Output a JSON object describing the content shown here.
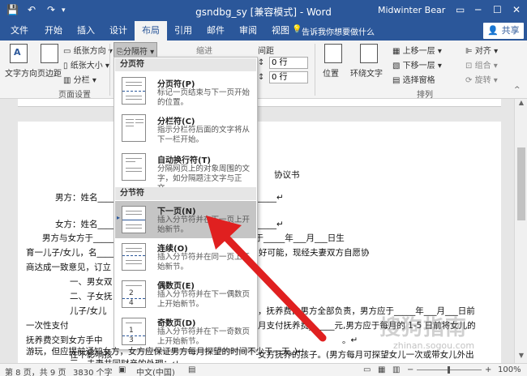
{
  "titlebar": {
    "save_glyph": "💾",
    "undo_glyph": "↶",
    "redo_glyph": "↷",
    "title": "gsndbg_sy [兼容模式] - Word",
    "user": "Midwinter Bear",
    "window_controls": [
      "▭",
      "─",
      "☐",
      "✕"
    ]
  },
  "tabs": [
    "文件",
    "开始",
    "插入",
    "设计",
    "布局",
    "引用",
    "邮件",
    "审阅",
    "视图"
  ],
  "active_tab": "布局",
  "tellme": "告诉我你想要做什么",
  "share": "共享",
  "ribbon": {
    "text_direction": "文字方向",
    "margins": "页边距",
    "orientation": "纸张方向",
    "size": "纸张大小",
    "columns": "分栏",
    "breaks": "分隔符",
    "page_setup": "页面设置",
    "indent": "缩进",
    "spacing": "间距",
    "spacing_before": "0 行",
    "spacing_after": "0 行",
    "position": "位置",
    "wrap_text": "环绕文字",
    "bring_forward": "上移一层",
    "send_backward": "下移一层",
    "selection_pane": "选择窗格",
    "align": "对齐",
    "group": "组合",
    "rotate": "旋转",
    "arrange": "排列"
  },
  "dropdown": {
    "page_breaks_header": "分页符",
    "section_breaks_header": "分节符",
    "items": [
      {
        "title": "分页符(P)",
        "desc": "标记一页结束与下一页开始的位置。"
      },
      {
        "title": "分栏符(C)",
        "desc": "指示分栏符后面的文字将从下一栏开始。"
      },
      {
        "title": "自动换行符(T)",
        "desc": "分隔网页上的对象周围的文字，如分隔题注文字与正文。"
      },
      {
        "title": "下一页(N)",
        "desc": "插入分节符并在下一页上开始新节。"
      },
      {
        "title": "连续(O)",
        "desc": "插入分节符并在同一页上开始新节。"
      },
      {
        "title": "偶数页(E)",
        "desc": "插入分节符并在下一偶数页上开始新节。"
      },
      {
        "title": "奇数页(D)",
        "desc": "插入分节符并在下一奇数页上开始新节。"
      }
    ]
  },
  "document": {
    "lines": [
      "协议书",
      "男方：姓名__________________________________________↵",
      "女方：姓名__________________________________________↵",
      "男方与女方于__________日在__________登记结婚，婚后于_____年___月___日生",
      "育一儿子/女儿，名__________，使夫妻感情确已破裂，已无和好可能，现经夫妻双方自愿协",
      "商达成一致意见，订立",
      "一、男女双",
      "二、子女抚",
      "儿子/女儿",
      "，抚养费由男方全部负责，男方应于_____年___月___日前",
      "一次性支付",
      "月支付抚养费______元,男方应于每月的 1-5 日前将女儿的",
      "抚养费交到女方手中",
      "。↵",
      "在不影响孩",
      "女方抚养的孩子。(男方每月可探望女儿一次或带女儿外出",
      "游玩，但应提前通知女方，女方应保证男方每月探望的时间不少于一天。)↵",
      "三、夫妻共同财产的处理：↵"
    ]
  },
  "status": {
    "page": "第 8 页，共 9 页",
    "words": "3830 个字",
    "lang": "中文(中国)",
    "zoom": "100%"
  },
  "watermark": {
    "text": "搜狗指南",
    "url": "zhinan.sogou.com"
  },
  "colors": {
    "word_blue": "#2b579a",
    "arrow_red": "#e02020",
    "highlight": "#c5c5c5"
  }
}
